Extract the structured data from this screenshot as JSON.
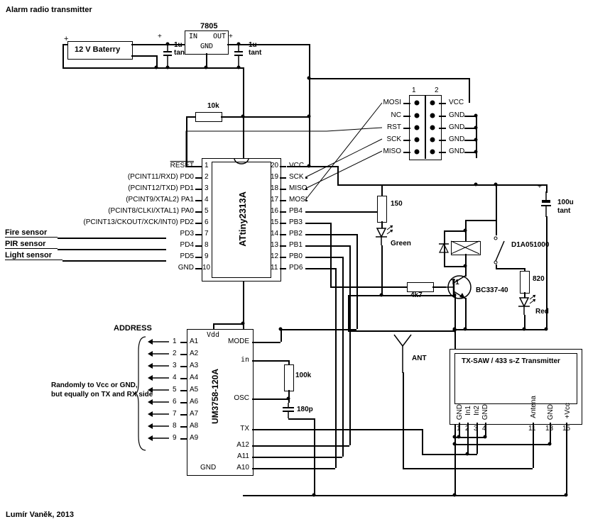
{
  "title": "Alarm radio transmitter",
  "author": "Lumír Vaněk, 2013",
  "power": {
    "battery": "12 V Baterry",
    "regulator": "7805",
    "reg_in": "IN",
    "reg_out": "OUT",
    "reg_gnd": "GND",
    "c1": "1u",
    "c1b": "tant",
    "c2": "1u",
    "c2b": "tant"
  },
  "r_pullup": "10k",
  "mcu": {
    "name": "ATtiny2313A",
    "left": [
      {
        "n": "1",
        "l": "RESET",
        "over": true
      },
      {
        "n": "2",
        "l": "(PCINT11/RXD) PD0"
      },
      {
        "n": "3",
        "l": "(PCINT12/TXD) PD1"
      },
      {
        "n": "4",
        "l": "(PCINT9/XTAL2) PA1"
      },
      {
        "n": "5",
        "l": "(PCINT8/CLKI/XTAL1) PA0"
      },
      {
        "n": "6",
        "l": "(PCINT13/CKOUT/XCK/INT0) PD2"
      },
      {
        "n": "7",
        "l": "PD3"
      },
      {
        "n": "8",
        "l": "PD4"
      },
      {
        "n": "9",
        "l": "PD5"
      },
      {
        "n": "10",
        "l": "GND"
      }
    ],
    "right": [
      {
        "n": "20",
        "l": "VCC"
      },
      {
        "n": "19",
        "l": "SCK"
      },
      {
        "n": "18",
        "l": "MISO"
      },
      {
        "n": "17",
        "l": "MOSI"
      },
      {
        "n": "16",
        "l": "PB4"
      },
      {
        "n": "15",
        "l": "PB3"
      },
      {
        "n": "14",
        "l": "PB2"
      },
      {
        "n": "13",
        "l": "PB1"
      },
      {
        "n": "12",
        "l": "PB0"
      },
      {
        "n": "11",
        "l": "PD6"
      }
    ]
  },
  "sensors": {
    "fire": "Fire sensor",
    "pir": "PIR sensor",
    "light": "Light sensor"
  },
  "header": {
    "left": [
      "MOSI",
      "NC",
      "RST",
      "SCK",
      "MISO"
    ],
    "right": [
      "VCC",
      "GND",
      "GND",
      "GND",
      "GND"
    ]
  },
  "led1": {
    "r": "150",
    "color": "Green"
  },
  "relay": "D1A051000",
  "tr": {
    "rb": "4k7",
    "name": "T1",
    "part": "BC337-40"
  },
  "out": {
    "c": "100u",
    "cb": "tant",
    "r": "820",
    "color": "Red"
  },
  "encoder": {
    "name": "UM3758-120A",
    "addr_title": "ADDRESS",
    "note1": "Randomly to Vcc or GND,",
    "note2": "but equally on TX and RX side",
    "vdd": "Vdd",
    "gnd": "GND",
    "pins": [
      "A1",
      "A2",
      "A3",
      "A4",
      "A5",
      "A6",
      "A7",
      "A8",
      "A9"
    ],
    "nums": [
      "1",
      "2",
      "3",
      "4",
      "5",
      "6",
      "7",
      "8",
      "9"
    ],
    "right": [
      "MODE",
      "in",
      "100k",
      "OSC",
      "180p",
      "TX",
      "A12",
      "A11",
      "A10"
    ],
    "r": "100k",
    "c": "180p"
  },
  "ant": "ANT",
  "txmod": {
    "title": "TX-SAW / 433 s-Z Transmitter",
    "pins": [
      {
        "n": "1",
        "l": "GND"
      },
      {
        "n": "2",
        "l": "In1"
      },
      {
        "n": "3",
        "l": "In2"
      },
      {
        "n": "4",
        "l": "GND"
      },
      {
        "n": "11",
        "l": "Antena"
      },
      {
        "n": "13",
        "l": "GND"
      },
      {
        "n": "15",
        "l": "+Vcc"
      }
    ]
  },
  "plus": "+"
}
